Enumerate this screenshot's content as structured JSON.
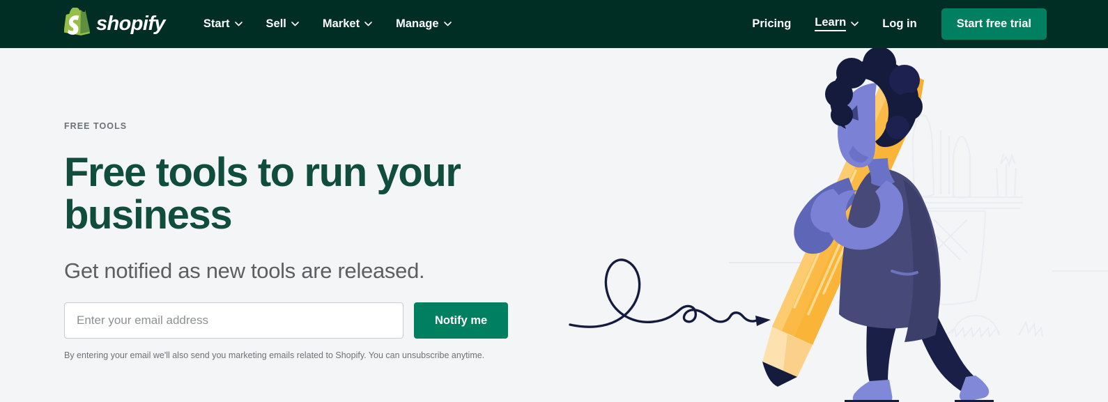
{
  "theme": {
    "header_bg": "#002E25",
    "page_bg": "#F4F5F7",
    "brand_green": "#008060",
    "heading_green": "#104D3D",
    "logo_green": "#95BF47",
    "body_text": "#5C5F62",
    "muted_text": "#6D7175",
    "pencil_yellow": "#FBBA45",
    "pencil_yellow_light": "#FDD07B",
    "pencil_wood": "#FDE2B0",
    "graphite_navy": "#151B3D",
    "skin_periwinkle": "#7B82D6",
    "coat_indigo": "#474A78",
    "hair_navy": "#151B3D",
    "leg_navy": "#1A1F47",
    "shoe_periwinkle": "#8088D8"
  },
  "header": {
    "logo": {
      "icon": "shopify-bag-icon",
      "letter": "S",
      "wordmark": "shopify"
    },
    "nav_main": [
      {
        "label": "Start",
        "icon": "chevron-down-icon",
        "has_chevron": true
      },
      {
        "label": "Sell",
        "icon": "chevron-down-icon",
        "has_chevron": true
      },
      {
        "label": "Market",
        "icon": "chevron-down-icon",
        "has_chevron": true
      },
      {
        "label": "Manage",
        "icon": "chevron-down-icon",
        "has_chevron": true
      }
    ],
    "nav_right": [
      {
        "label": "Pricing",
        "has_chevron": false,
        "active": false
      },
      {
        "label": "Learn",
        "icon": "chevron-down-icon",
        "has_chevron": true,
        "active": true
      },
      {
        "label": "Log in",
        "has_chevron": false,
        "active": false
      }
    ],
    "cta": {
      "label": "Start free trial"
    }
  },
  "hero": {
    "eyebrow": "FREE TOOLS",
    "title": "Free tools to run your business",
    "subtitle": "Get notified as new tools are released.",
    "form": {
      "email_placeholder": "Enter your email address",
      "email_value": "",
      "submit_label": "Notify me"
    },
    "fineprint": "By entering your email we'll also send you marketing emails related to Shopify. You can unsubscribe anytime.",
    "illustration": {
      "name": "woman-holding-giant-pencil-illustration",
      "elements": [
        "giant-yellow-pencil",
        "handwritten-scribble-line",
        "woman-figure",
        "faint-pencil-cup-sketch",
        "floor-line"
      ]
    }
  }
}
